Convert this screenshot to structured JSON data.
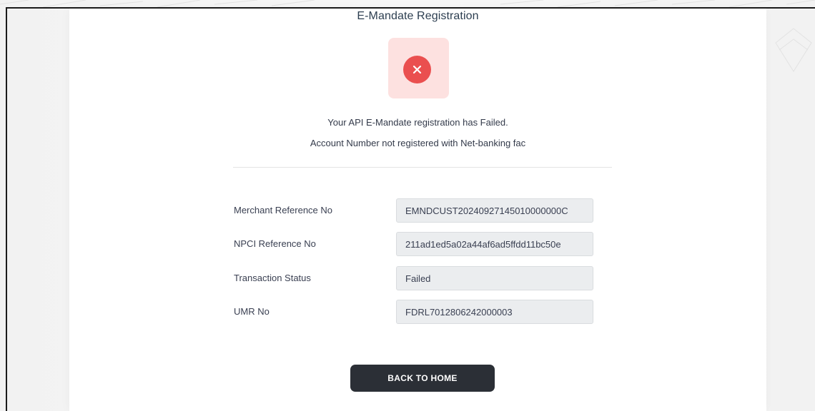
{
  "page": {
    "title": "E-Mandate Registration",
    "status_icon": "close-icon",
    "status_color": "#ea4f4f",
    "status_bg_color": "#fde1e0"
  },
  "messages": {
    "line1": "Your API E-Mandate registration has Failed.",
    "line2": "Account Number not registered with Net-banking fac"
  },
  "details": [
    {
      "label": "Merchant Reference No",
      "value": "EMNDCUST20240927145010000000C"
    },
    {
      "label": "NPCI Reference No",
      "value": "211ad1ed5a02a44af6ad5ffdd11bc50e"
    },
    {
      "label": "Transaction Status",
      "value": "Failed"
    },
    {
      "label": "UMR No",
      "value": "FDRL7012806242000003"
    }
  ],
  "actions": {
    "back_label": "BACK TO HOME",
    "button_color": "#2b2f36"
  }
}
